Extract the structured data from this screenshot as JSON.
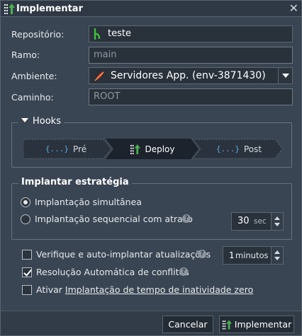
{
  "dialog": {
    "title": "Implementar"
  },
  "form": {
    "repository": {
      "label": "Repositório:",
      "value": "teste"
    },
    "branch": {
      "label": "Ramo:",
      "value": "main"
    },
    "environment": {
      "label": "Ambiente:",
      "value": "Servidores App. (env-3871430)"
    },
    "path": {
      "label": "Caminho:",
      "value": "ROOT"
    }
  },
  "hooks": {
    "legend": "Hooks",
    "items": [
      {
        "label": "Pré",
        "icon": "curly-braces-icon"
      },
      {
        "label": "Deploy",
        "icon": "deploy-icon"
      },
      {
        "label": "Post",
        "icon": "curly-braces-icon"
      }
    ],
    "curly_glyph": "{...}"
  },
  "strategy": {
    "legend": "Implantar estratégia",
    "options": [
      {
        "label": "Implantação simultânea",
        "selected": true
      },
      {
        "label": "Implantação sequencial com atraso",
        "selected": false
      }
    ],
    "delay": {
      "value": "30",
      "unit": "sec"
    }
  },
  "options": {
    "auto_update": {
      "label": "Verifique e auto-implantar atualizações",
      "checked": false
    },
    "auto_update_interval": {
      "value": "1",
      "unit": "minutos"
    },
    "auto_resolve": {
      "label": "Resolução Automática de conflitos",
      "checked": true
    },
    "zero_downtime": {
      "prefix": "Ativar ",
      "link": "Implantação de tempo de inatividade zero",
      "checked": false
    }
  },
  "footer": {
    "cancel_label": "Cancelar",
    "submit_label": "Implementar"
  },
  "colors": {
    "accent": "#4caf50",
    "hook_active": "#1c232c",
    "hook_inactive": "#2a323d",
    "help_glyph": "?"
  }
}
